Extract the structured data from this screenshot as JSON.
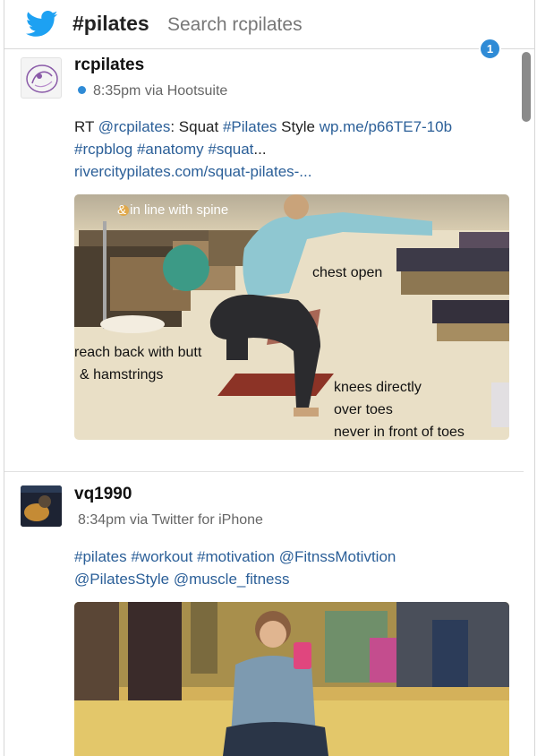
{
  "header": {
    "hashtag": "#pilates",
    "search_hint": "Search rcpilates"
  },
  "badge_count": "1",
  "tweets": [
    {
      "username": "rcpilates",
      "time_via": "8:35pm via Hootsuite",
      "text": {
        "rt": "RT ",
        "mention": "@rcpilates",
        "sep1": ": Squat ",
        "tag1": "#Pilates",
        "word": " Style ",
        "link1": "wp.me/p66TE7-10b",
        "sp1": " ",
        "tag2": "#rcpblog",
        "sp2": "  ",
        "tag3": "#anatomy",
        "sp3": " ",
        "tag4": "#squat",
        "ellipsis": "...",
        "link2": "rivercitypilates.com/squat-pilates-..."
      },
      "media_labels": {
        "spine": "& in line with spine",
        "chest": "chest open",
        "reach": "reach back with butt",
        "hamstrings": "& hamstrings",
        "knees1": "knees directly",
        "knees2": "over toes",
        "knees3": "never in front of toes"
      }
    },
    {
      "username": "vq1990",
      "time_via": "8:34pm via Twitter for iPhone",
      "text": {
        "t1": "#pilates",
        "t2": "#workout",
        "t3": "#motivation",
        "m1": "@FitnssMotivtion",
        "m2": "@PilatesStyle",
        "m3": "@muscle_fitness"
      }
    }
  ],
  "colors": {
    "accent": "#2f8bd6",
    "link": "#2b5f98"
  }
}
